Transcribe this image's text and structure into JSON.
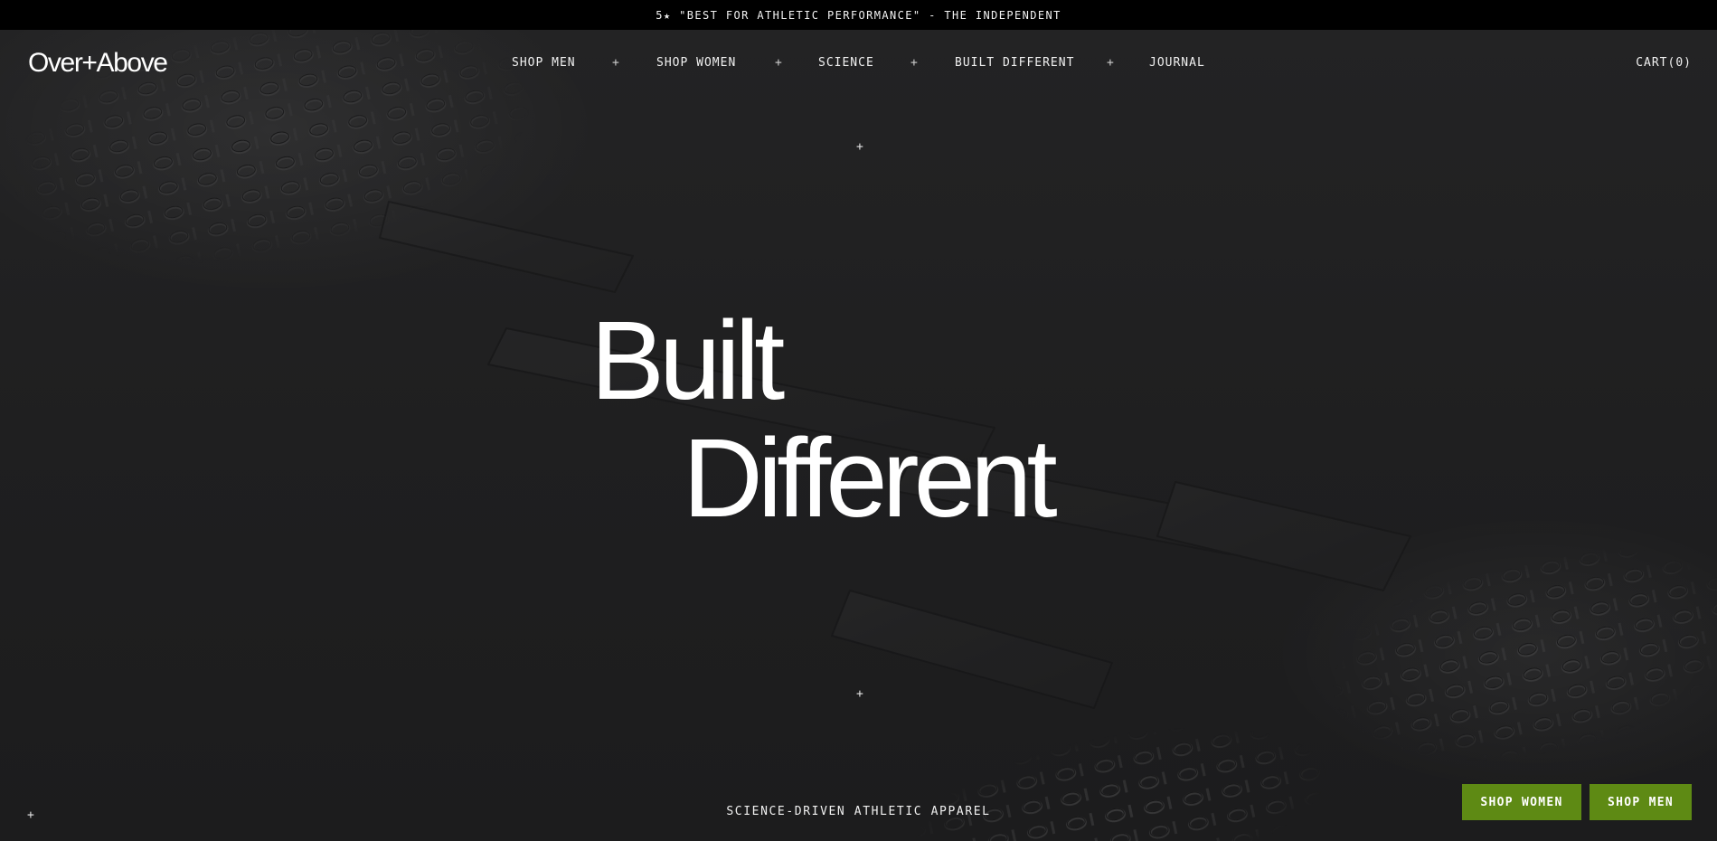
{
  "announcement": "5★ \"BEST FOR ATHLETIC PERFORMANCE\" - THE INDEPENDENT",
  "header": {
    "logo": "Over+Above",
    "nav": [
      {
        "label": "SHOP MEN",
        "expand": "+"
      },
      {
        "label": "SHOP WOMEN",
        "expand": "+"
      },
      {
        "label": "SCIENCE",
        "expand": "+"
      },
      {
        "label": "BUILT DIFFERENT",
        "expand": "+"
      },
      {
        "label": "JOURNAL"
      }
    ],
    "cart": "CART(0)"
  },
  "hero": {
    "headline_line1": "Built",
    "headline_line2": "Different",
    "tagline": "SCIENCE-DRIVEN ATHLETIC APPAREL",
    "marker": "+",
    "buttons": {
      "shop_women": "SHOP WOMEN",
      "shop_men": "SHOP MEN"
    }
  },
  "colors": {
    "announcement_bg": "#000000",
    "hero_bg": "#1f1f20",
    "button_bg": "#5e8a14",
    "text": "#ffffff"
  }
}
